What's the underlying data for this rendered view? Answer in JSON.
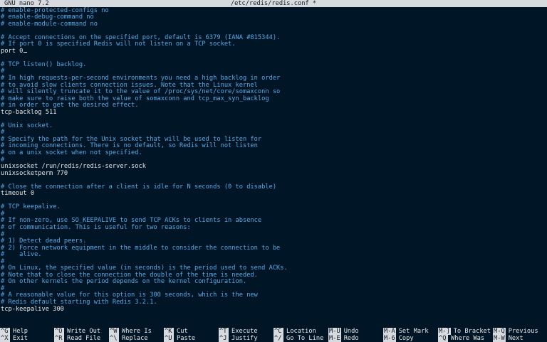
{
  "titlebar": {
    "app": "GNU nano 7.2",
    "file": "/etc/redis/redis.conf *"
  },
  "editor": {
    "lines": [
      {
        "type": "comment",
        "text": "# enable-protected-configs no"
      },
      {
        "type": "comment",
        "text": "# enable-debug-command no"
      },
      {
        "type": "comment",
        "text": "# enable-module-command no"
      },
      {
        "type": "blank",
        "text": ""
      },
      {
        "type": "comment",
        "text": "# Accept connections on the specified port, default is 6379 (IANA #815344)."
      },
      {
        "type": "comment",
        "text": "# If port 0 is specified Redis will not listen on a TCP socket."
      },
      {
        "type": "directive",
        "text": "port 0",
        "cursor": true
      },
      {
        "type": "blank",
        "text": ""
      },
      {
        "type": "comment",
        "text": "# TCP listen() backlog."
      },
      {
        "type": "comment",
        "text": "#"
      },
      {
        "type": "comment",
        "text": "# In high requests-per-second environments you need a high backlog in order"
      },
      {
        "type": "comment",
        "text": "# to avoid slow clients connection issues. Note that the Linux kernel"
      },
      {
        "type": "comment",
        "text": "# will silently truncate it to the value of /proc/sys/net/core/somaxconn so"
      },
      {
        "type": "comment",
        "text": "# make sure to raise both the value of somaxconn and tcp_max_syn_backlog"
      },
      {
        "type": "comment",
        "text": "# in order to get the desired effect."
      },
      {
        "type": "directive",
        "text": "tcp-backlog 511"
      },
      {
        "type": "blank",
        "text": ""
      },
      {
        "type": "comment",
        "text": "# Unix socket."
      },
      {
        "type": "comment",
        "text": "#"
      },
      {
        "type": "comment",
        "text": "# Specify the path for the Unix socket that will be used to listen for"
      },
      {
        "type": "comment",
        "text": "# incoming connections. There is no default, so Redis will not listen"
      },
      {
        "type": "comment",
        "text": "# on a unix socket when not specified."
      },
      {
        "type": "comment",
        "text": "#"
      },
      {
        "type": "directive",
        "text": "unixsocket /run/redis/redis-server.sock"
      },
      {
        "type": "directive",
        "text": "unixsocketperm 770"
      },
      {
        "type": "blank",
        "text": ""
      },
      {
        "type": "comment",
        "text": "# Close the connection after a client is idle for N seconds (0 to disable)"
      },
      {
        "type": "directive",
        "text": "timeout 0"
      },
      {
        "type": "blank",
        "text": ""
      },
      {
        "type": "comment",
        "text": "# TCP keepalive."
      },
      {
        "type": "comment",
        "text": "#"
      },
      {
        "type": "comment",
        "text": "# If non-zero, use SO_KEEPALIVE to send TCP ACKs to clients in absence"
      },
      {
        "type": "comment",
        "text": "# of communication. This is useful for two reasons:"
      },
      {
        "type": "comment",
        "text": "#"
      },
      {
        "type": "comment",
        "text": "# 1) Detect dead peers."
      },
      {
        "type": "comment",
        "text": "# 2) Force network equipment in the middle to consider the connection to be"
      },
      {
        "type": "comment",
        "text": "#    alive."
      },
      {
        "type": "comment",
        "text": "#"
      },
      {
        "type": "comment",
        "text": "# On Linux, the specified value (in seconds) is the period used to send ACKs."
      },
      {
        "type": "comment",
        "text": "# Note that to close the connection the double of the time is needed."
      },
      {
        "type": "comment",
        "text": "# On other kernels the period depends on the kernel configuration."
      },
      {
        "type": "comment",
        "text": "#"
      },
      {
        "type": "comment",
        "text": "# A reasonable value for this option is 300 seconds, which is the new"
      },
      {
        "type": "comment",
        "text": "# Redis default starting with Redis 3.2.1."
      },
      {
        "type": "directive",
        "text": "tcp-keepalive 300"
      }
    ]
  },
  "shortcuts": [
    {
      "key": "^G",
      "label": "Help"
    },
    {
      "key": "^X",
      "label": "Exit"
    },
    {
      "key": "^O",
      "label": "Write Out"
    },
    {
      "key": "^R",
      "label": "Read File"
    },
    {
      "key": "^W",
      "label": "Where Is"
    },
    {
      "key": "^\\",
      "label": "Replace"
    },
    {
      "key": "^K",
      "label": "Cut"
    },
    {
      "key": "^U",
      "label": "Paste"
    },
    {
      "key": "^T",
      "label": "Execute"
    },
    {
      "key": "^J",
      "label": "Justify"
    },
    {
      "key": "^C",
      "label": "Location"
    },
    {
      "key": "^/",
      "label": "Go To Line"
    },
    {
      "key": "M-U",
      "label": "Undo"
    },
    {
      "key": "M-E",
      "label": "Redo"
    },
    {
      "key": "M-A",
      "label": "Set Mark"
    },
    {
      "key": "M-6",
      "label": "Copy"
    },
    {
      "key": "M-]",
      "label": "To Bracket"
    },
    {
      "key": "^Q",
      "label": "Where Was"
    },
    {
      "key": "M-Q",
      "label": "Previous"
    },
    {
      "key": "M-W",
      "label": "Next"
    }
  ],
  "colors": {
    "background": "#001626",
    "comment": "#58a8e6",
    "text": "#e6e6e6",
    "bar": "#d7dbe0"
  }
}
